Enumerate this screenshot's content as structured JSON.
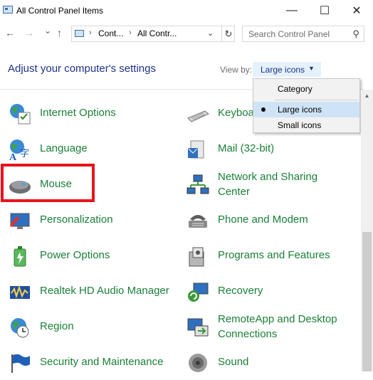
{
  "window": {
    "title": "All Control Panel Items",
    "minimize_glyph": "—",
    "maximize_glyph": "☐",
    "close_glyph": "✕"
  },
  "address": {
    "back_glyph": "←",
    "forward_glyph": "→",
    "recent_glyph": "⌄",
    "up_glyph": "↑",
    "crumbs": [
      "Cont...",
      "All Contr..."
    ],
    "sep_glyph": "›",
    "dropdown_glyph": "⌄",
    "refresh_glyph": "↻"
  },
  "search": {
    "placeholder": "Search Control Panel",
    "icon": "search-icon"
  },
  "heading": "Adjust your computer's settings",
  "view_by": {
    "label": "View by:",
    "value": "Large icons",
    "caret": "▼"
  },
  "view_menu": {
    "options": [
      "Category",
      "Large icons",
      "Small icons"
    ],
    "selected": "Large icons"
  },
  "items_left": [
    {
      "label": "Internet Options",
      "icon": "internet-options-icon"
    },
    {
      "label": "Language",
      "icon": "language-icon"
    },
    {
      "label": "Mouse",
      "icon": "mouse-icon"
    },
    {
      "label": "Personalization",
      "icon": "personalization-icon"
    },
    {
      "label": "Power Options",
      "icon": "power-options-icon"
    },
    {
      "label": "Realtek HD Audio Manager",
      "icon": "realtek-audio-icon"
    },
    {
      "label": "Region",
      "icon": "region-icon"
    },
    {
      "label": "Security and Maintenance",
      "icon": "security-flag-icon"
    }
  ],
  "items_right": [
    {
      "label": "Keyboard",
      "icon": "keyboard-icon"
    },
    {
      "label": "Mail (32-bit)",
      "icon": "mail-icon"
    },
    {
      "label_line1": "Network and Sharing",
      "label_line2": "Center",
      "icon": "network-icon"
    },
    {
      "label": "Phone and Modem",
      "icon": "phone-modem-icon"
    },
    {
      "label": "Programs and Features",
      "icon": "programs-icon"
    },
    {
      "label": "Recovery",
      "icon": "recovery-icon"
    },
    {
      "label_line1": "RemoteApp and Desktop",
      "label_line2": "Connections",
      "icon": "remoteapp-icon"
    },
    {
      "label": "Sound",
      "icon": "sound-icon"
    }
  ],
  "colors": {
    "link_green": "#1a7f37",
    "heading_blue": "#1e3287",
    "highlight_red": "#e8131b",
    "dropdown_selected": "#cfe3f7"
  }
}
